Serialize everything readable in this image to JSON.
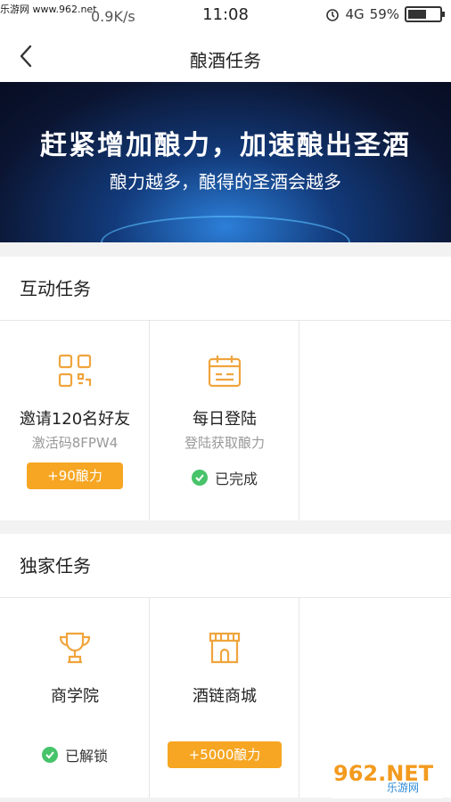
{
  "status_bar": {
    "site": "乐游网 www.962.net",
    "speed": "0.9K/s",
    "time": "11:08",
    "network": "4G",
    "battery_pct": "59%",
    "battery_level": 0.59
  },
  "nav": {
    "title": "酿酒任务"
  },
  "banner": {
    "headline": "赶紧增加酿力，加速酿出圣酒",
    "subtitle": "酿力越多，酿得的圣酒会越多"
  },
  "sections": [
    {
      "title": "互动任务",
      "tasks": [
        {
          "icon": "qr-code-icon",
          "name": "邀请120名好友",
          "desc": "激活码8FPW4",
          "reward": "+90酿力"
        },
        {
          "icon": "calendar-icon",
          "name": "每日登陆",
          "desc": "登陆获取酿力",
          "status": "已完成"
        }
      ]
    },
    {
      "title": "独家任务",
      "tasks": [
        {
          "icon": "trophy-icon",
          "name": "商学院",
          "status": "已解锁"
        },
        {
          "icon": "store-icon",
          "name": "酒链商城",
          "reward": "+5000酿力"
        }
      ]
    }
  ],
  "watermark": {
    "logo": "962.NET",
    "text": "乐游网"
  },
  "colors": {
    "accent": "#f6a623",
    "success": "#47c36a",
    "icon": "#f0a43c"
  }
}
